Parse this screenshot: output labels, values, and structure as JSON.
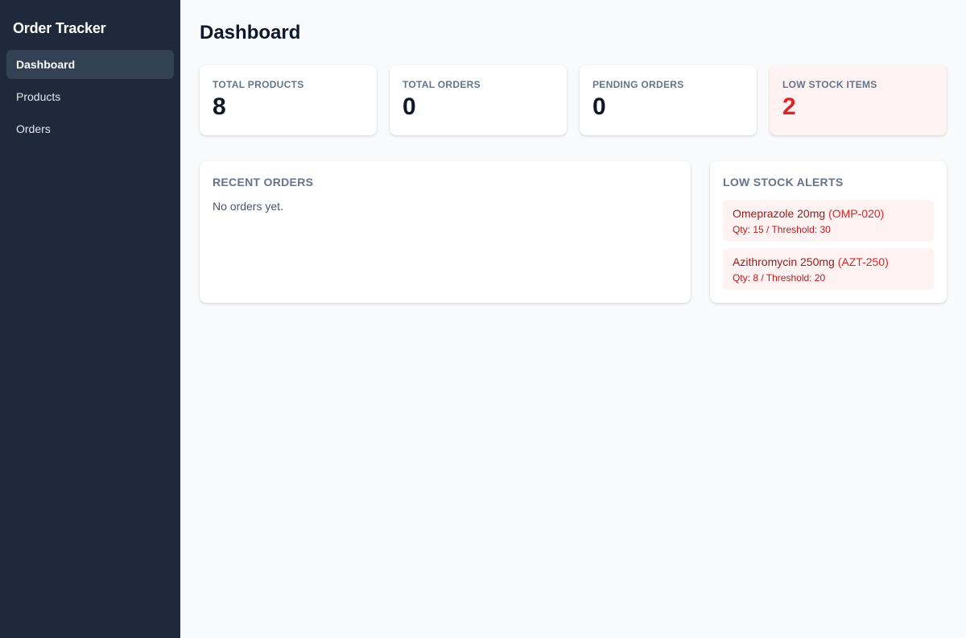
{
  "app": {
    "title": "Order Tracker"
  },
  "sidebar": {
    "items": [
      {
        "label": "Dashboard"
      },
      {
        "label": "Products"
      },
      {
        "label": "Orders"
      }
    ]
  },
  "page": {
    "title": "Dashboard"
  },
  "stats": [
    {
      "label": "TOTAL PRODUCTS",
      "value": "8"
    },
    {
      "label": "TOTAL ORDERS",
      "value": "0"
    },
    {
      "label": "PENDING ORDERS",
      "value": "0"
    },
    {
      "label": "LOW STOCK ITEMS",
      "value": "2"
    }
  ],
  "recent_orders": {
    "title": "RECENT ORDERS",
    "empty_text": "No orders yet."
  },
  "low_stock": {
    "title": "LOW STOCK ALERTS",
    "items": [
      {
        "name": "Omeprazole 20mg",
        "sku": "(OMP-020)",
        "meta": "Qty: 15 / Threshold: 30"
      },
      {
        "name": "Azithromycin 250mg",
        "sku": "(AZT-250)",
        "meta": "Qty: 8 / Threshold: 20"
      }
    ]
  },
  "colors": {
    "sidebar_bg": "#1e293b",
    "active_nav_bg": "#334155",
    "alert_bg": "#fef2f2",
    "alert_accent": "#dc2626"
  }
}
